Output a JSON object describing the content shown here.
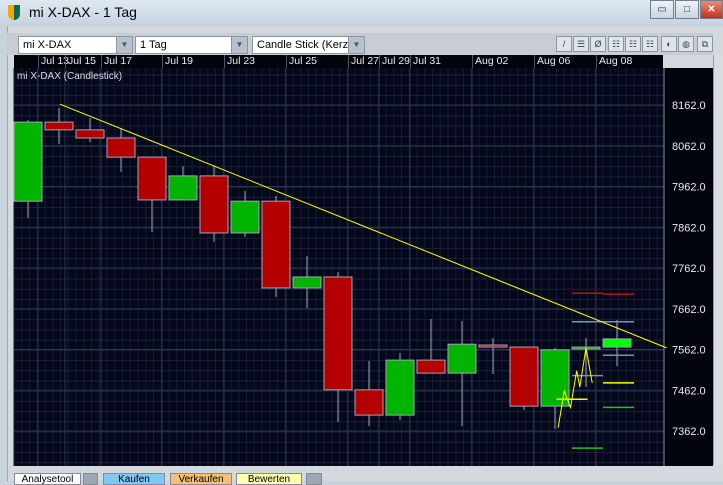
{
  "window": {
    "title": "mi X-DAX - 1 Tag",
    "minimize": "▭",
    "maximize": "□",
    "close": "✕"
  },
  "toolbar": {
    "instrument": "mi X-DAX",
    "period": "1 Tag",
    "chart_type": "Candle Stick (Kerze"
  },
  "chart_label": "mi X-DAX (Candlestick)",
  "bottom_tabs": [
    "Analysetool",
    "Kaufen",
    "Verkaufen",
    "Bewerten"
  ],
  "colors": {
    "up": "#00b400",
    "down": "#b40000",
    "last": "#00ff00",
    "trend": "#ffff00",
    "bg": "#0a0f22"
  },
  "chart_data": {
    "type": "candlestick",
    "title": "mi X-DAX (Candlestick)",
    "x_tick_labels": [
      "Jul 13",
      "Jul 15",
      "Jul 17",
      "Jul 19",
      "Jul 23",
      "Jul 25",
      "Jul 27",
      "Jul 29",
      "Jul 31",
      "Aug 02",
      "Aug 06",
      "Aug 08"
    ],
    "y_tick_labels": [
      "8162.0",
      "8062.0",
      "7962.0",
      "7862.0",
      "7762.0",
      "7662.0",
      "7562.0",
      "7462.0",
      "7362.0"
    ],
    "ylim": [
      7300,
      8230
    ],
    "candles": [
      {
        "o": 7926,
        "h": 8125,
        "l": 7885,
        "c": 8120
      },
      {
        "o": 8120,
        "h": 8155,
        "l": 8066,
        "c": 8101
      },
      {
        "o": 8101,
        "h": 8130,
        "l": 8071,
        "c": 8081
      },
      {
        "o": 8081,
        "h": 8106,
        "l": 7998,
        "c": 8034
      },
      {
        "o": 8034,
        "h": 8034,
        "l": 7850,
        "c": 7929
      },
      {
        "o": 7929,
        "h": 8012,
        "l": 7929,
        "c": 7988
      },
      {
        "o": 7988,
        "h": 8012,
        "l": 7826,
        "c": 7848
      },
      {
        "o": 7848,
        "h": 7951,
        "l": 7838,
        "c": 7926
      },
      {
        "o": 7926,
        "h": 7939,
        "l": 7691,
        "c": 7713
      },
      {
        "o": 7713,
        "h": 7791,
        "l": 7664,
        "c": 7740
      },
      {
        "o": 7740,
        "h": 7752,
        "l": 7384,
        "c": 7463
      },
      {
        "o": 7463,
        "h": 7534,
        "l": 7374,
        "c": 7401
      },
      {
        "o": 7401,
        "h": 7553,
        "l": 7389,
        "c": 7536
      },
      {
        "o": 7536,
        "h": 7637,
        "l": 7504,
        "c": 7504
      },
      {
        "o": 7504,
        "h": 7632,
        "l": 7374,
        "c": 7575
      },
      {
        "o": 7573,
        "h": 7590,
        "l": 7502,
        "c": 7568
      },
      {
        "o": 7568,
        "h": 7568,
        "l": 7414,
        "c": 7423
      },
      {
        "o": 7423,
        "h": 7566,
        "l": 7367,
        "c": 7561
      },
      {
        "o": 7566,
        "h": 7590,
        "l": 7470,
        "c": 7568
      },
      {
        "o": 7568,
        "h": 7634,
        "l": 7521,
        "c": 7588
      }
    ],
    "trendline": {
      "from": {
        "index": 1,
        "price": 8164
      },
      "to": {
        "index": 20.6,
        "price": 7566
      }
    },
    "zigzag": [
      [
        17.1,
        7370
      ],
      [
        17.3,
        7460
      ],
      [
        17.5,
        7420
      ],
      [
        17.7,
        7510
      ],
      [
        17.8,
        7470
      ],
      [
        18.0,
        7566
      ],
      [
        18.2,
        7480
      ]
    ],
    "levels": [
      {
        "from": 18,
        "to": 19,
        "price": 7700,
        "color": "#c01010"
      },
      {
        "from": 19,
        "to": 20,
        "price": 7698,
        "color": "#c01010"
      },
      {
        "from": 18,
        "to": 19,
        "price": 7630,
        "color": "#8090c0"
      },
      {
        "from": 19,
        "to": 20,
        "price": 7630,
        "color": "#8090c0"
      },
      {
        "from": 19,
        "to": 20,
        "price": 7548,
        "color": "#8090a0"
      },
      {
        "from": 18,
        "to": 19,
        "price": 7498,
        "color": "#8090a0"
      },
      {
        "from": 19,
        "to": 20,
        "price": 7480,
        "color": "#ffff00"
      },
      {
        "from": 17.5,
        "to": 18.5,
        "price": 7440,
        "color": "#ffff00"
      },
      {
        "from": 19,
        "to": 20,
        "price": 7420,
        "color": "#20c020"
      },
      {
        "from": 18,
        "to": 19,
        "price": 7320,
        "color": "#20c020"
      }
    ]
  }
}
